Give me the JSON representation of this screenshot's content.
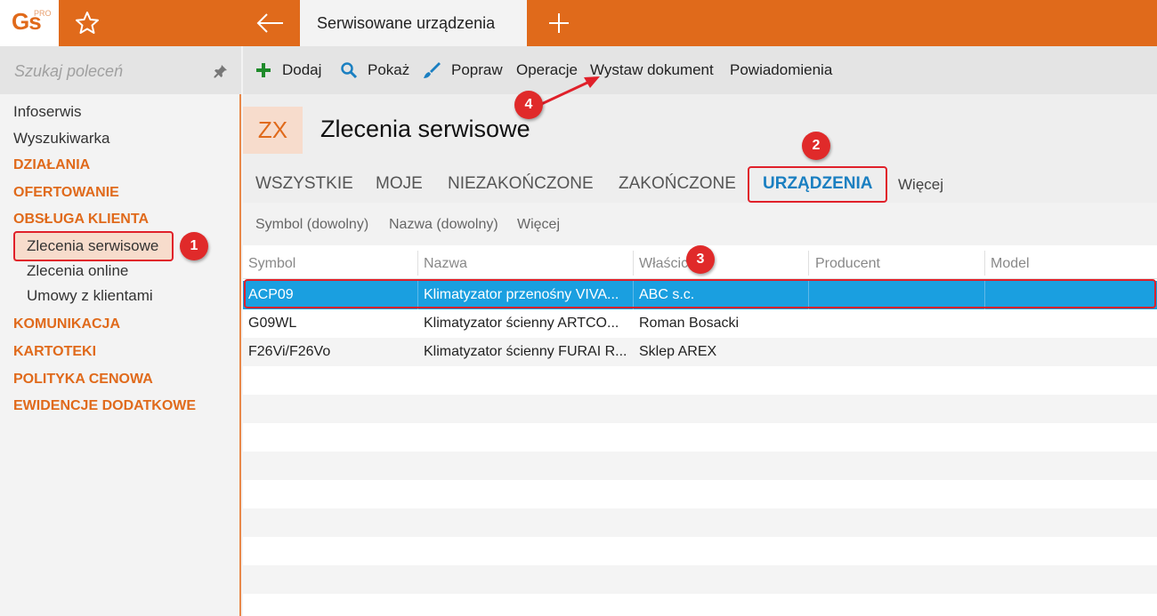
{
  "topbar": {
    "logo_text": "Gs",
    "logo_badge": "PRO",
    "active_tab": "Serwisowane urządzenia",
    "icons": [
      "star-icon",
      "back-arrow-icon",
      "plus-icon"
    ],
    "color": "#e06a1b"
  },
  "sidebar": {
    "search_placeholder": "Szukaj poleceń",
    "items": [
      {
        "label": "Infoserwis",
        "kind": "plain"
      },
      {
        "label": "Wyszukiwarka",
        "kind": "plain"
      },
      {
        "label": "DZIAŁANIA",
        "kind": "category"
      },
      {
        "label": "OFERTOWANIE",
        "kind": "category"
      },
      {
        "label": "OBSŁUGA KLIENTA",
        "kind": "category"
      },
      {
        "label": "Zlecenia serwisowe",
        "kind": "sub",
        "selected": true
      },
      {
        "label": "Zlecenia online",
        "kind": "sub"
      },
      {
        "label": "Umowy z klientami",
        "kind": "sub"
      },
      {
        "label": "KOMUNIKACJA",
        "kind": "category"
      },
      {
        "label": "KARTOTEKI",
        "kind": "category"
      },
      {
        "label": "POLITYKA CENOWA",
        "kind": "category"
      },
      {
        "label": "EWIDENCJE DODATKOWE",
        "kind": "category"
      }
    ]
  },
  "toolbar": {
    "add": "Dodaj",
    "show": "Pokaż",
    "edit": "Popraw",
    "operations": "Operacje",
    "issue_document": "Wystaw dokument",
    "notifications": "Powiadomienia"
  },
  "header": {
    "badge": "ZX",
    "title": "Zlecenia serwisowe"
  },
  "tabs": [
    "WSZYSTKIE",
    "MOJE",
    "NIEZAKOŃCZONE",
    "ZAKOŃCZONE",
    "URZĄDZENIA",
    "Więcej"
  ],
  "active_tab": "URZĄDZENIA",
  "filters": [
    "Symbol (dowolny)",
    "Nazwa (dowolny)",
    "Więcej"
  ],
  "table": {
    "columns": [
      "Symbol",
      "Nazwa",
      "Właściciel",
      "Producent",
      "Model"
    ],
    "rows": [
      {
        "symbol": "ACP09",
        "name": "Klimatyzator przenośny VIVA...",
        "owner": "ABC s.c.",
        "producer": "",
        "model": "",
        "selected": true
      },
      {
        "symbol": "G09WL",
        "name": "Klimatyzator ścienny ARTCO...",
        "owner": "Roman Bosacki",
        "producer": "",
        "model": ""
      },
      {
        "symbol": "F26Vi/F26Vo",
        "name": "Klimatyzator ścienny FURAI R...",
        "owner": "Sklep AREX",
        "producer": "",
        "model": ""
      }
    ]
  },
  "annotations": {
    "badges": [
      "1",
      "2",
      "3",
      "4"
    ]
  }
}
